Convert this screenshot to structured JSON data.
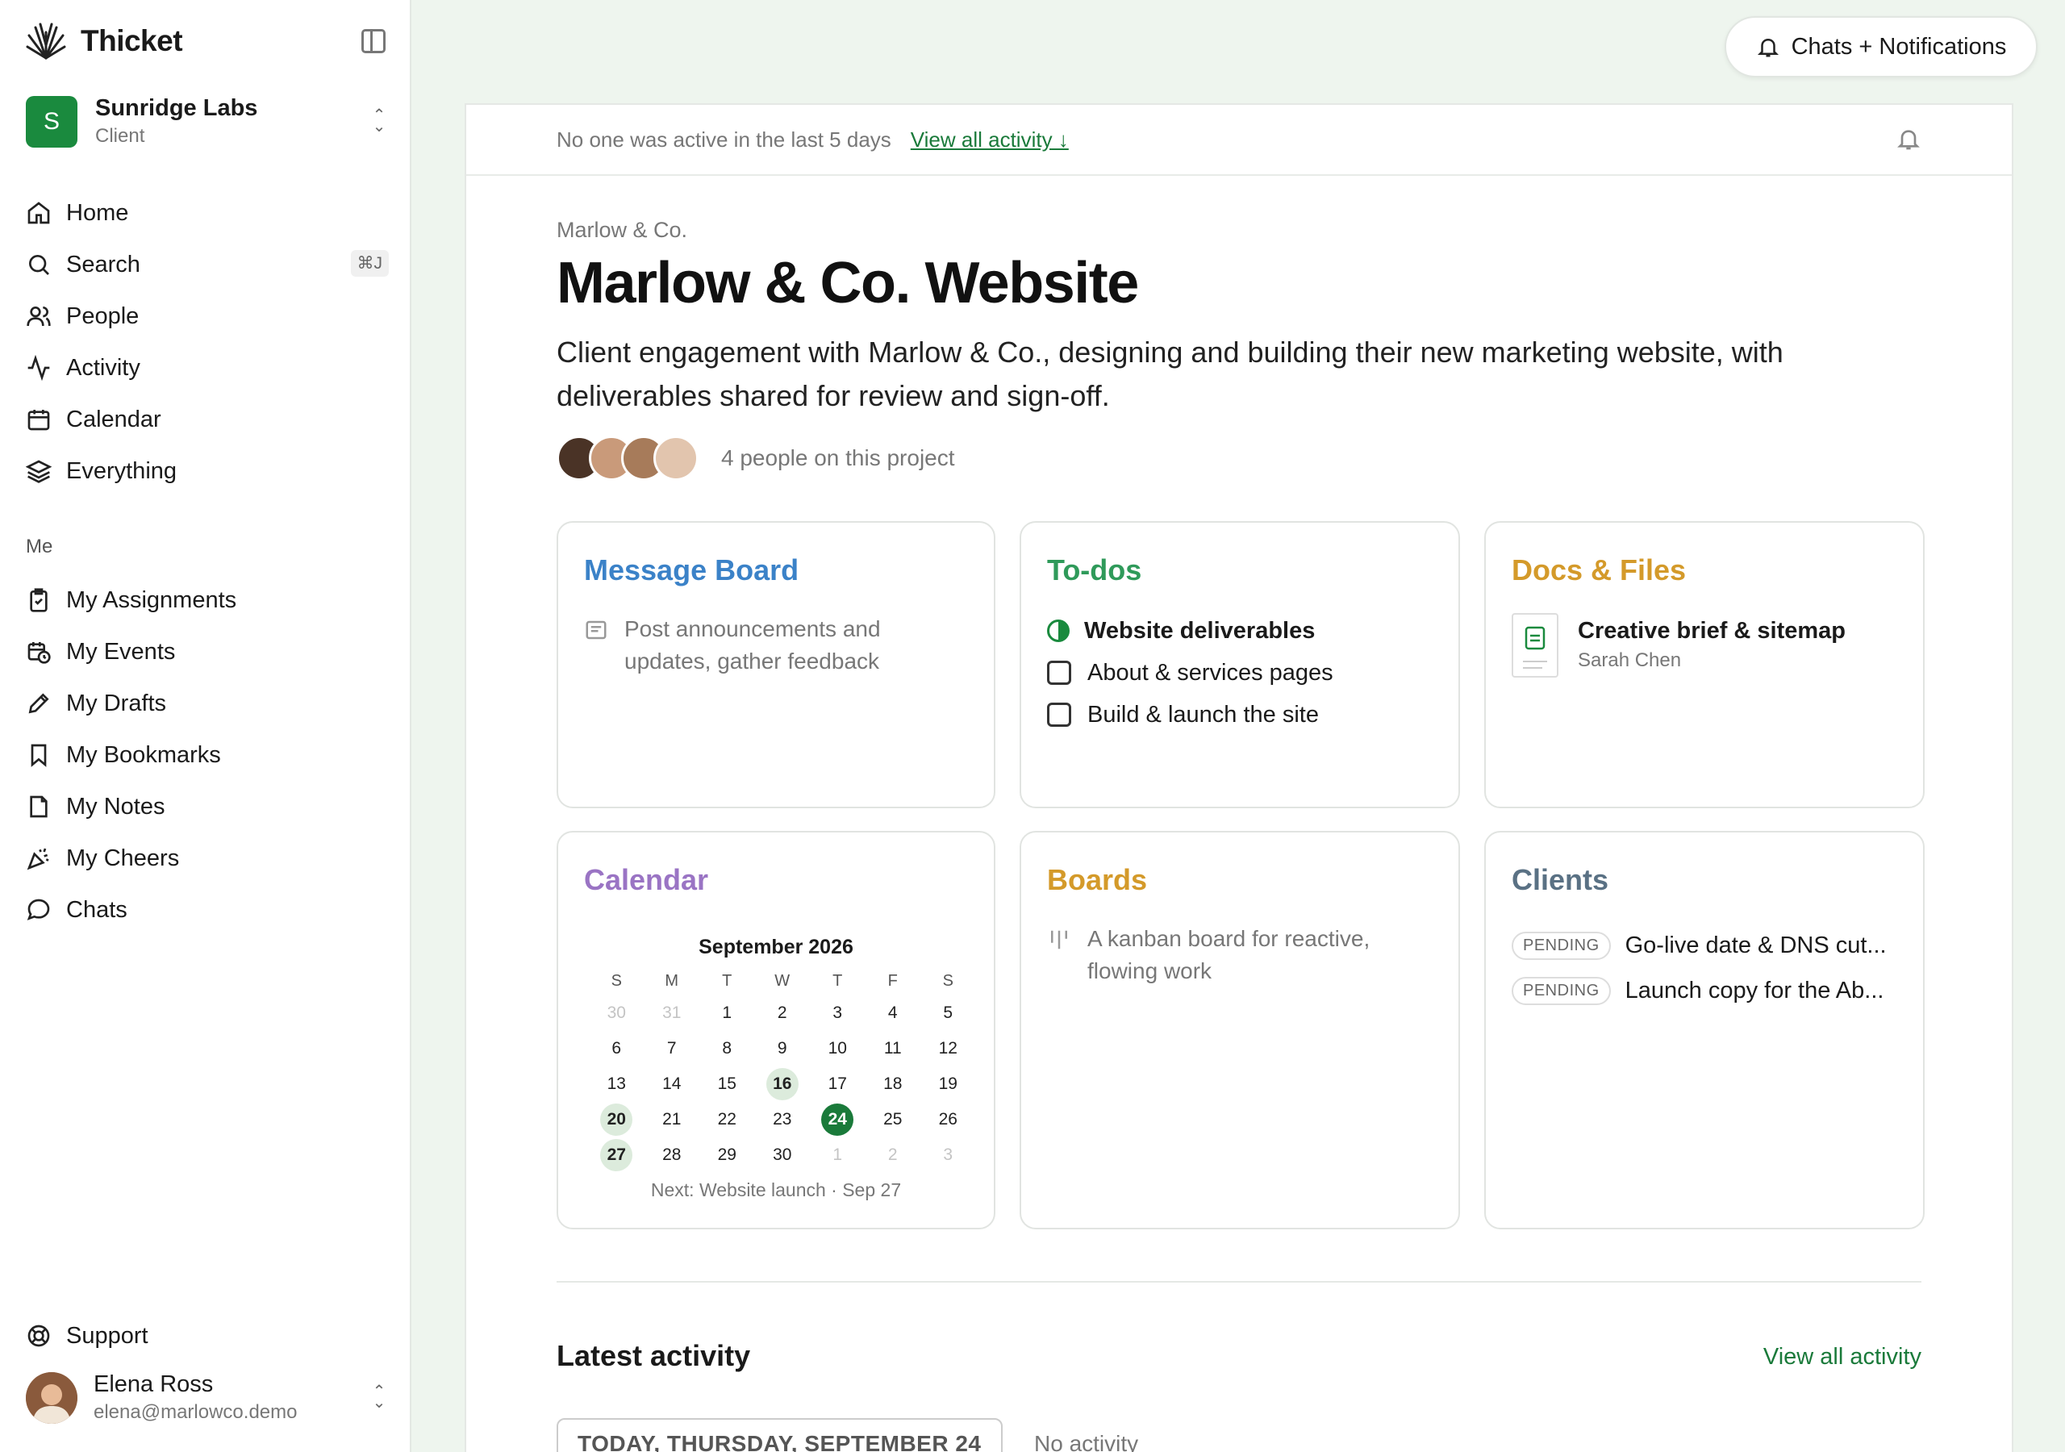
{
  "app": {
    "name": "Thicket"
  },
  "workspace": {
    "initial": "S",
    "name": "Sunridge Labs",
    "role": "Client"
  },
  "nav": [
    {
      "label": "Home",
      "icon": "home-icon"
    },
    {
      "label": "Search",
      "icon": "search-icon",
      "shortcut": "⌘J"
    },
    {
      "label": "People",
      "icon": "people-icon"
    },
    {
      "label": "Activity",
      "icon": "activity-icon"
    },
    {
      "label": "Calendar",
      "icon": "calendar-icon"
    },
    {
      "label": "Everything",
      "icon": "layers-icon"
    }
  ],
  "me_label": "Me",
  "me_nav": [
    {
      "label": "My Assignments",
      "icon": "clipboard-check-icon"
    },
    {
      "label": "My Events",
      "icon": "calendar-clock-icon"
    },
    {
      "label": "My Drafts",
      "icon": "pencil-icon"
    },
    {
      "label": "My Bookmarks",
      "icon": "bookmark-icon"
    },
    {
      "label": "My Notes",
      "icon": "note-icon"
    },
    {
      "label": "My Cheers",
      "icon": "party-popper-icon"
    },
    {
      "label": "Chats",
      "icon": "chat-bubble-icon"
    }
  ],
  "support": {
    "label": "Support",
    "icon": "lifebuoy-icon"
  },
  "user": {
    "name": "Elena Ross",
    "email": "elena@marlowco.demo"
  },
  "top": {
    "chats_button": "Chats + Notifications"
  },
  "alert": {
    "text": "No one was active in the last 5 days",
    "link": "View all activity ↓"
  },
  "project": {
    "client": "Marlow & Co.",
    "title": "Marlow & Co. Website",
    "description": "Client engagement with Marlow & Co., designing and building their new marketing website, with deliverables shared for review and sign-off.",
    "people_text": "4 people on this project"
  },
  "cards": {
    "message_board": {
      "title": "Message Board",
      "text": "Post announcements and updates, gather feedback",
      "color": "#3b82c8"
    },
    "todos": {
      "title": "To-dos",
      "color": "#2f9a5a",
      "list": "Website deliverables",
      "items": [
        "About & services pages",
        "Build & launch the site"
      ]
    },
    "docs": {
      "title": "Docs & Files",
      "color": "#d49a2a",
      "file": "Creative brief & sitemap",
      "author": "Sarah Chen"
    },
    "calendar": {
      "title": "Calendar",
      "color": "#9a74c4",
      "month": "September 2026",
      "next": "Next: Website launch · Sep 27",
      "dow": [
        "S",
        "M",
        "T",
        "W",
        "T",
        "F",
        "S"
      ],
      "days": [
        "30",
        "31",
        "1",
        "2",
        "3",
        "4",
        "5",
        "6",
        "7",
        "8",
        "9",
        "10",
        "11",
        "12",
        "13",
        "14",
        "15",
        "16",
        "17",
        "18",
        "19",
        "20",
        "21",
        "22",
        "23",
        "24",
        "25",
        "26",
        "27",
        "28",
        "29",
        "30",
        "1",
        "2",
        "3"
      ]
    },
    "boards": {
      "title": "Boards",
      "color": "#d49a2a",
      "text": "A kanban board for reactive, flowing work"
    },
    "clients": {
      "title": "Clients",
      "color": "#5a7184",
      "badge": "PENDING",
      "items": [
        "Go-live date & DNS cut...",
        "Launch copy for the Ab..."
      ]
    }
  },
  "latest": {
    "title": "Latest activity",
    "view_all": "View all activity",
    "day": "TODAY, THURSDAY, SEPTEMBER 24",
    "empty": "No activity"
  }
}
